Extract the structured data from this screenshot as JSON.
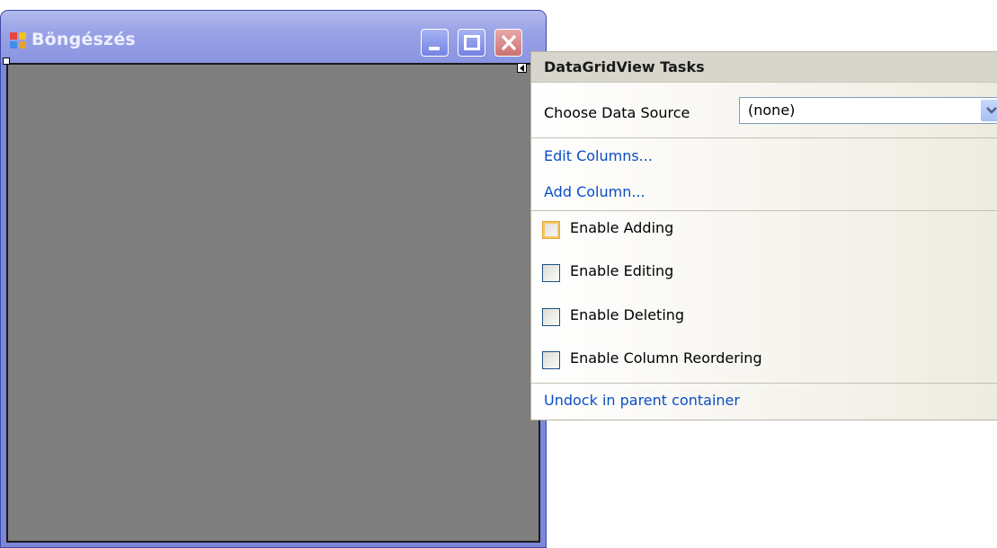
{
  "window": {
    "title": "Böngészés",
    "title_icon": "form-app-icon",
    "buttons": [
      "minimize-icon",
      "maximize-icon",
      "close-icon"
    ]
  },
  "panel": {
    "header": "DataGridView Tasks",
    "data_source": {
      "label": "Choose Data Source",
      "value": "(none)"
    },
    "links": {
      "edit_columns": "Edit Columns...",
      "add_column": "Add Column...",
      "undock": "Undock in parent container"
    },
    "options": [
      {
        "label": "Enable Adding",
        "checked": false
      },
      {
        "label": "Enable Editing",
        "checked": false
      },
      {
        "label": "Enable Deleting",
        "checked": false
      },
      {
        "label": "Enable Column Reordering",
        "checked": false
      }
    ]
  },
  "colors": {
    "title_bar": "#9aa3e6",
    "grid_background": "#7f7f7f",
    "link": "#0a4ec4",
    "panel_header": "#d8d6cc"
  }
}
